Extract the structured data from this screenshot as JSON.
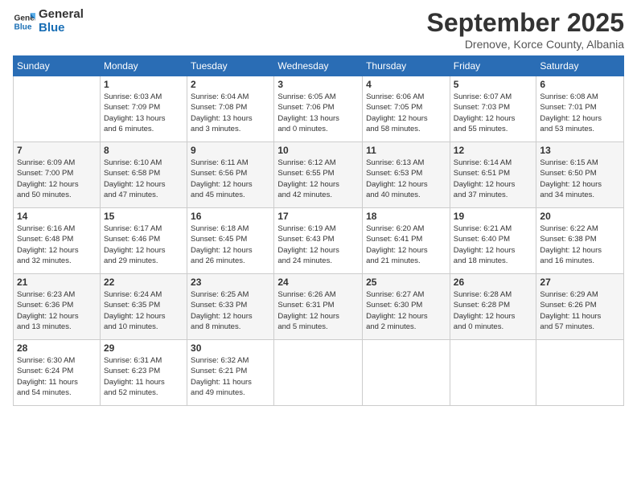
{
  "logo": {
    "line1": "General",
    "line2": "Blue"
  },
  "header": {
    "month": "September 2025",
    "location": "Drenove, Korce County, Albania"
  },
  "weekdays": [
    "Sunday",
    "Monday",
    "Tuesday",
    "Wednesday",
    "Thursday",
    "Friday",
    "Saturday"
  ],
  "weeks": [
    [
      {
        "day": "",
        "info": ""
      },
      {
        "day": "1",
        "info": "Sunrise: 6:03 AM\nSunset: 7:09 PM\nDaylight: 13 hours\nand 6 minutes."
      },
      {
        "day": "2",
        "info": "Sunrise: 6:04 AM\nSunset: 7:08 PM\nDaylight: 13 hours\nand 3 minutes."
      },
      {
        "day": "3",
        "info": "Sunrise: 6:05 AM\nSunset: 7:06 PM\nDaylight: 13 hours\nand 0 minutes."
      },
      {
        "day": "4",
        "info": "Sunrise: 6:06 AM\nSunset: 7:05 PM\nDaylight: 12 hours\nand 58 minutes."
      },
      {
        "day": "5",
        "info": "Sunrise: 6:07 AM\nSunset: 7:03 PM\nDaylight: 12 hours\nand 55 minutes."
      },
      {
        "day": "6",
        "info": "Sunrise: 6:08 AM\nSunset: 7:01 PM\nDaylight: 12 hours\nand 53 minutes."
      }
    ],
    [
      {
        "day": "7",
        "info": "Sunrise: 6:09 AM\nSunset: 7:00 PM\nDaylight: 12 hours\nand 50 minutes."
      },
      {
        "day": "8",
        "info": "Sunrise: 6:10 AM\nSunset: 6:58 PM\nDaylight: 12 hours\nand 47 minutes."
      },
      {
        "day": "9",
        "info": "Sunrise: 6:11 AM\nSunset: 6:56 PM\nDaylight: 12 hours\nand 45 minutes."
      },
      {
        "day": "10",
        "info": "Sunrise: 6:12 AM\nSunset: 6:55 PM\nDaylight: 12 hours\nand 42 minutes."
      },
      {
        "day": "11",
        "info": "Sunrise: 6:13 AM\nSunset: 6:53 PM\nDaylight: 12 hours\nand 40 minutes."
      },
      {
        "day": "12",
        "info": "Sunrise: 6:14 AM\nSunset: 6:51 PM\nDaylight: 12 hours\nand 37 minutes."
      },
      {
        "day": "13",
        "info": "Sunrise: 6:15 AM\nSunset: 6:50 PM\nDaylight: 12 hours\nand 34 minutes."
      }
    ],
    [
      {
        "day": "14",
        "info": "Sunrise: 6:16 AM\nSunset: 6:48 PM\nDaylight: 12 hours\nand 32 minutes."
      },
      {
        "day": "15",
        "info": "Sunrise: 6:17 AM\nSunset: 6:46 PM\nDaylight: 12 hours\nand 29 minutes."
      },
      {
        "day": "16",
        "info": "Sunrise: 6:18 AM\nSunset: 6:45 PM\nDaylight: 12 hours\nand 26 minutes."
      },
      {
        "day": "17",
        "info": "Sunrise: 6:19 AM\nSunset: 6:43 PM\nDaylight: 12 hours\nand 24 minutes."
      },
      {
        "day": "18",
        "info": "Sunrise: 6:20 AM\nSunset: 6:41 PM\nDaylight: 12 hours\nand 21 minutes."
      },
      {
        "day": "19",
        "info": "Sunrise: 6:21 AM\nSunset: 6:40 PM\nDaylight: 12 hours\nand 18 minutes."
      },
      {
        "day": "20",
        "info": "Sunrise: 6:22 AM\nSunset: 6:38 PM\nDaylight: 12 hours\nand 16 minutes."
      }
    ],
    [
      {
        "day": "21",
        "info": "Sunrise: 6:23 AM\nSunset: 6:36 PM\nDaylight: 12 hours\nand 13 minutes."
      },
      {
        "day": "22",
        "info": "Sunrise: 6:24 AM\nSunset: 6:35 PM\nDaylight: 12 hours\nand 10 minutes."
      },
      {
        "day": "23",
        "info": "Sunrise: 6:25 AM\nSunset: 6:33 PM\nDaylight: 12 hours\nand 8 minutes."
      },
      {
        "day": "24",
        "info": "Sunrise: 6:26 AM\nSunset: 6:31 PM\nDaylight: 12 hours\nand 5 minutes."
      },
      {
        "day": "25",
        "info": "Sunrise: 6:27 AM\nSunset: 6:30 PM\nDaylight: 12 hours\nand 2 minutes."
      },
      {
        "day": "26",
        "info": "Sunrise: 6:28 AM\nSunset: 6:28 PM\nDaylight: 12 hours\nand 0 minutes."
      },
      {
        "day": "27",
        "info": "Sunrise: 6:29 AM\nSunset: 6:26 PM\nDaylight: 11 hours\nand 57 minutes."
      }
    ],
    [
      {
        "day": "28",
        "info": "Sunrise: 6:30 AM\nSunset: 6:24 PM\nDaylight: 11 hours\nand 54 minutes."
      },
      {
        "day": "29",
        "info": "Sunrise: 6:31 AM\nSunset: 6:23 PM\nDaylight: 11 hours\nand 52 minutes."
      },
      {
        "day": "30",
        "info": "Sunrise: 6:32 AM\nSunset: 6:21 PM\nDaylight: 11 hours\nand 49 minutes."
      },
      {
        "day": "",
        "info": ""
      },
      {
        "day": "",
        "info": ""
      },
      {
        "day": "",
        "info": ""
      },
      {
        "day": "",
        "info": ""
      }
    ]
  ]
}
